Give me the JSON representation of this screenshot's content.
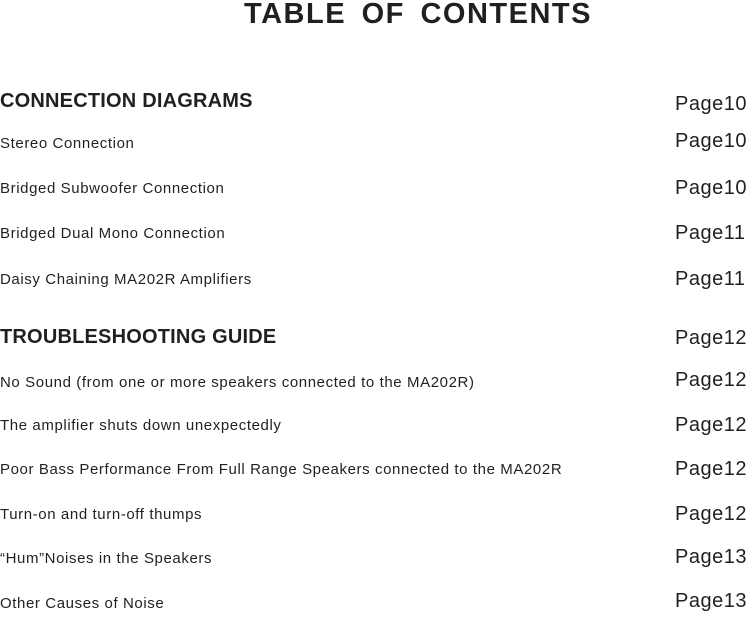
{
  "title": "TABLE  OF  CONTENTS",
  "entries": [
    {
      "label": "CONNECTION DIAGRAMS",
      "page": "Page10",
      "type": "section"
    },
    {
      "label": "Stereo Connection",
      "page": "Page10",
      "type": "item"
    },
    {
      "label": "Bridged Subwoofer Connection",
      "page": "Page10",
      "type": "item"
    },
    {
      "label": "Bridged Dual Mono Connection",
      "page": "Page11",
      "type": "item"
    },
    {
      "label": "Daisy Chaining MA202R Amplifiers",
      "page": "Page11",
      "type": "item"
    },
    {
      "label": "TROUBLESHOOTING GUIDE",
      "page": "Page12",
      "type": "section"
    },
    {
      "label": "No Sound (from one or more speakers connected to the MA202R)",
      "page": "Page12",
      "type": "item"
    },
    {
      "label": "The amplifier shuts down unexpectedly",
      "page": "Page12",
      "type": "item"
    },
    {
      "label": "Poor Bass Performance From Full Range Speakers connected to the MA202R",
      "page": "Page12",
      "type": "item"
    },
    {
      "label": "Turn-on and turn-off thumps",
      "page": "Page12",
      "type": "item"
    },
    {
      "label": "“Hum”Noises in the Speakers",
      "page": "Page13",
      "type": "item"
    },
    {
      "label": "Other  Causes of Noise",
      "page": "Page13",
      "type": "item"
    }
  ]
}
